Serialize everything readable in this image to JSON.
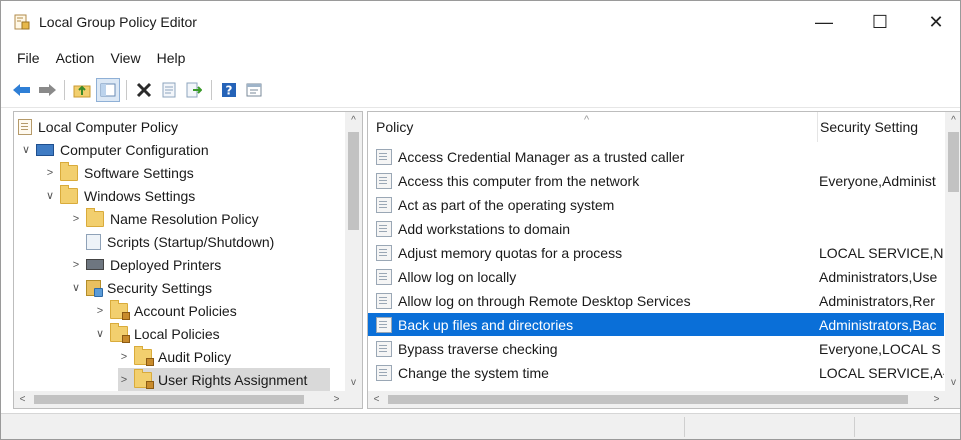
{
  "window": {
    "title": "Local Group Policy Editor",
    "minimize": "—",
    "maximize": "☐",
    "close": "✕"
  },
  "menu": [
    "File",
    "Action",
    "View",
    "Help"
  ],
  "toolbar": {
    "icons": [
      "back-arrow-icon",
      "forward-arrow-icon",
      "up-folder-icon",
      "show-hide-tree-icon",
      "delete-icon",
      "properties-icon",
      "export-list-icon",
      "help-icon",
      "filter-icon"
    ]
  },
  "tree": {
    "items": [
      {
        "label": "Local Computer Policy",
        "expander": "",
        "icon": "policy-doc-icon"
      },
      {
        "label": "Computer Configuration",
        "expander": "∨",
        "icon": "computer-icon"
      },
      {
        "label": "Software Settings",
        "expander": ">",
        "icon": "folder-icon"
      },
      {
        "label": "Windows Settings",
        "expander": "∨",
        "icon": "folder-icon"
      },
      {
        "label": "Name Resolution Policy",
        "expander": ">",
        "icon": "folder-icon"
      },
      {
        "label": "Scripts (Startup/Shutdown)",
        "expander": "",
        "icon": "script-icon"
      },
      {
        "label": "Deployed Printers",
        "expander": ">",
        "icon": "printer-icon"
      },
      {
        "label": "Security Settings",
        "expander": "∨",
        "icon": "security-settings-icon"
      },
      {
        "label": "Account Policies",
        "expander": ">",
        "icon": "secure-folder-icon"
      },
      {
        "label": "Local Policies",
        "expander": "∨",
        "icon": "secure-folder-icon"
      },
      {
        "label": "Audit Policy",
        "expander": ">",
        "icon": "secure-folder-icon"
      },
      {
        "label": "User Rights Assignment",
        "expander": ">",
        "icon": "secure-folder-icon",
        "selected": true
      }
    ]
  },
  "list": {
    "columns": {
      "policy": "Policy",
      "setting": "Security Setting",
      "sort_indicator": "^"
    },
    "rows": [
      {
        "policy": "Access Credential Manager as a trusted caller",
        "setting": ""
      },
      {
        "policy": "Access this computer from the network",
        "setting": "Everyone,Administ"
      },
      {
        "policy": "Act as part of the operating system",
        "setting": ""
      },
      {
        "policy": "Add workstations to domain",
        "setting": ""
      },
      {
        "policy": "Adjust memory quotas for a process",
        "setting": "LOCAL SERVICE,NI"
      },
      {
        "policy": "Allow log on locally",
        "setting": "Administrators,Use"
      },
      {
        "policy": "Allow log on through Remote Desktop Services",
        "setting": "Administrators,Rer"
      },
      {
        "policy": "Back up files and directories",
        "setting": "Administrators,Bac",
        "selected": true
      },
      {
        "policy": "Bypass traverse checking",
        "setting": "Everyone,LOCAL S"
      },
      {
        "policy": "Change the system time",
        "setting": "LOCAL SERVICE,A‹"
      }
    ]
  },
  "scroll": {
    "up": "^",
    "down": "v",
    "left": "<",
    "right": ">"
  },
  "colors": {
    "selection": "#0a6fd8",
    "tree_selection": "#d9d9d9",
    "folder": "#f2cf6e"
  }
}
